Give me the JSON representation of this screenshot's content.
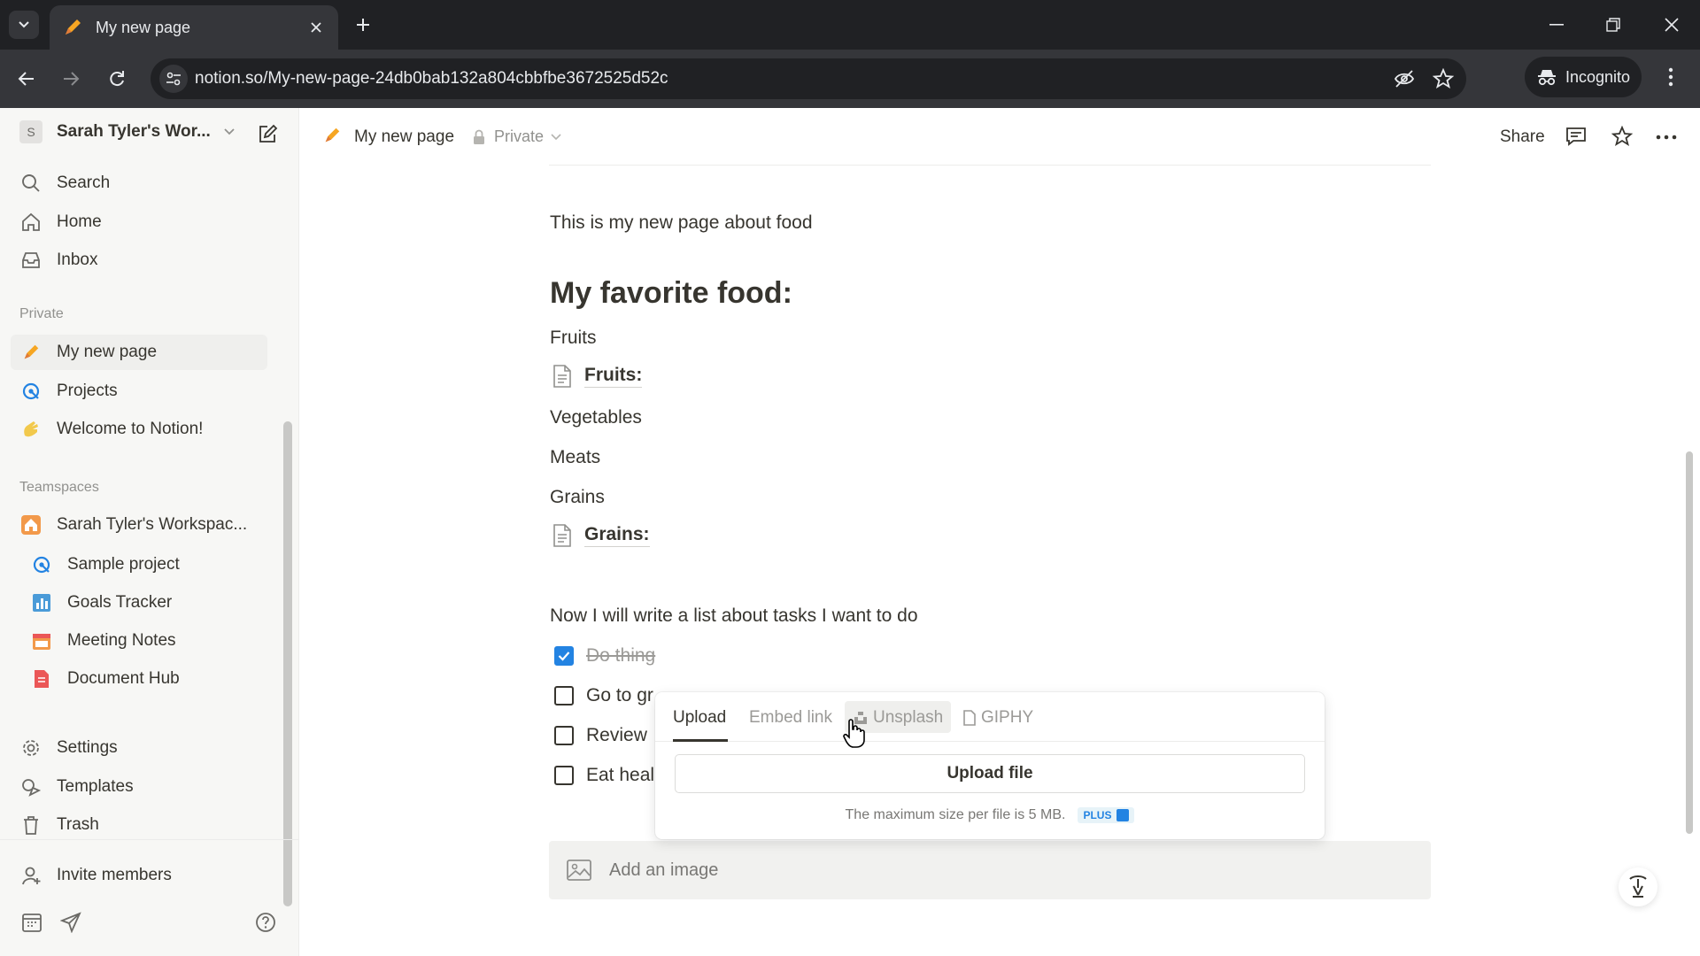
{
  "browser": {
    "tab_title": "My new page",
    "url": "notion.so/My-new-page-24db0bab132a804cbbfbe3672525d52c",
    "incognito_label": "Incognito"
  },
  "sidebar": {
    "workspace_avatar": "S",
    "workspace_name": "Sarah Tyler's Wor...",
    "nav": [
      {
        "label": "Search",
        "icon": "search-icon"
      },
      {
        "label": "Home",
        "icon": "home-icon"
      },
      {
        "label": "Inbox",
        "icon": "inbox-icon"
      }
    ],
    "private_heading": "Private",
    "private_pages": [
      {
        "label": "My new page",
        "icon": "pencil-icon"
      },
      {
        "label": "Projects",
        "icon": "projects-icon"
      },
      {
        "label": "Welcome to Notion!",
        "icon": "wave-icon"
      }
    ],
    "teamspaces_heading": "Teamspaces",
    "teamspace_name": "Sarah Tyler's Workspac...",
    "teamspace_pages": [
      {
        "label": "Sample project",
        "icon": "projects-icon"
      },
      {
        "label": "Goals Tracker",
        "icon": "chart-icon"
      },
      {
        "label": "Meeting Notes",
        "icon": "calendar-icon"
      },
      {
        "label": "Document Hub",
        "icon": "document-icon"
      }
    ],
    "footer_items": [
      {
        "label": "Settings",
        "icon": "gear-icon"
      },
      {
        "label": "Templates",
        "icon": "templates-icon"
      },
      {
        "label": "Trash",
        "icon": "trash-icon"
      }
    ],
    "invite_label": "Invite members"
  },
  "topbar": {
    "page_title": "My new page",
    "privacy": "Private",
    "share_label": "Share"
  },
  "page": {
    "intro": "This is my new page about food",
    "heading": "My favorite food:",
    "items": {
      "fruits_text": "Fruits",
      "fruits_link": "Fruits:",
      "vegetables": "Vegetables",
      "meats": "Meats",
      "grains_text": "Grains",
      "grains_link": "Grains:"
    },
    "tasks_intro": "Now I will write a list about tasks I want to do",
    "todos": [
      {
        "text": "Do thing",
        "checked": true
      },
      {
        "text": "Go to gr",
        "checked": false
      },
      {
        "text": "Review",
        "checked": false
      },
      {
        "text": "Eat heal",
        "checked": false
      }
    ],
    "add_image_label": "Add an image"
  },
  "popover": {
    "tabs": [
      "Upload",
      "Embed link",
      "Unsplash",
      "GIPHY"
    ],
    "active_tab": "Upload",
    "upload_button": "Upload file",
    "note": "The maximum size per file is 5 MB.",
    "plan_badge": "PLUS"
  },
  "colors": {
    "accent": "#2383e2",
    "sidebar_bg": "#f7f7f5",
    "text": "#37352f",
    "muted": "#91918e"
  }
}
